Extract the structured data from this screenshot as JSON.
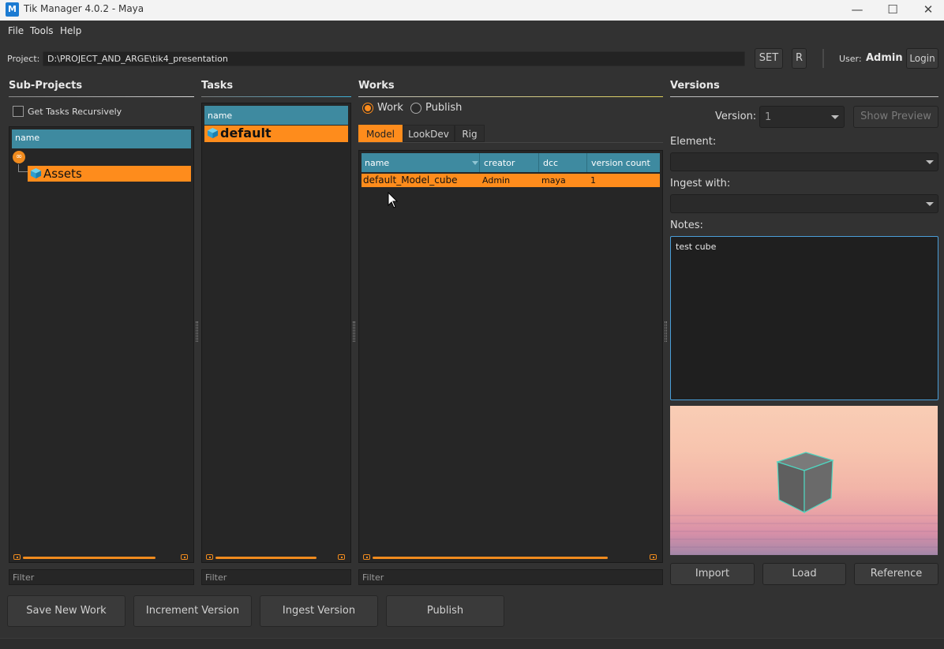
{
  "window": {
    "app_icon_letter": "M",
    "title": "Tik Manager 4.0.2 - Maya",
    "minimize": "—",
    "maximize": "☐",
    "close": "✕"
  },
  "menu": [
    "File",
    "Tools",
    "Help"
  ],
  "project": {
    "label": "Project:",
    "path": "D:\\PROJECT_AND_ARGE\\tik4_presentation",
    "set_button": "SET",
    "r_button": "R",
    "user_label": "User:",
    "user_name": "Admin",
    "login_button": "Login"
  },
  "subprojects": {
    "title": "Sub-Projects",
    "recursive_label": "Get Tasks Recursively",
    "recursive_checked": false,
    "column": "name",
    "items": [
      "Assets"
    ],
    "filter_placeholder": "Filter"
  },
  "tasks": {
    "title": "Tasks",
    "column": "name",
    "items": [
      "default"
    ],
    "filter_placeholder": "Filter"
  },
  "works": {
    "title": "Works",
    "mode_work": "Work",
    "mode_publish": "Publish",
    "selected_mode": "Work",
    "tabs": [
      "Model",
      "LookDev",
      "Rig"
    ],
    "active_tab": "Model",
    "columns": [
      "name",
      "creator",
      "dcc",
      "version count"
    ],
    "rows": [
      {
        "name": "default_Model_cube",
        "creator": "Admin",
        "dcc": "maya",
        "version_count": "1"
      }
    ],
    "filter_placeholder": "Filter"
  },
  "versions": {
    "title": "Versions",
    "version_label": "Version:",
    "version_value": "1",
    "show_preview": "Show Preview",
    "element_label": "Element:",
    "ingest_label": "Ingest with:",
    "notes_label": "Notes:",
    "notes": "test cube",
    "import_button": "Import",
    "load_button": "Load",
    "reference_button": "Reference"
  },
  "bottom_buttons": [
    "Save New Work",
    "Increment Version",
    "Ingest Version",
    "Publish"
  ],
  "colors": {
    "accent": "#fe8c1c",
    "header_teal": "#3e8aa0",
    "background": "#323232",
    "panel": "#262626"
  }
}
